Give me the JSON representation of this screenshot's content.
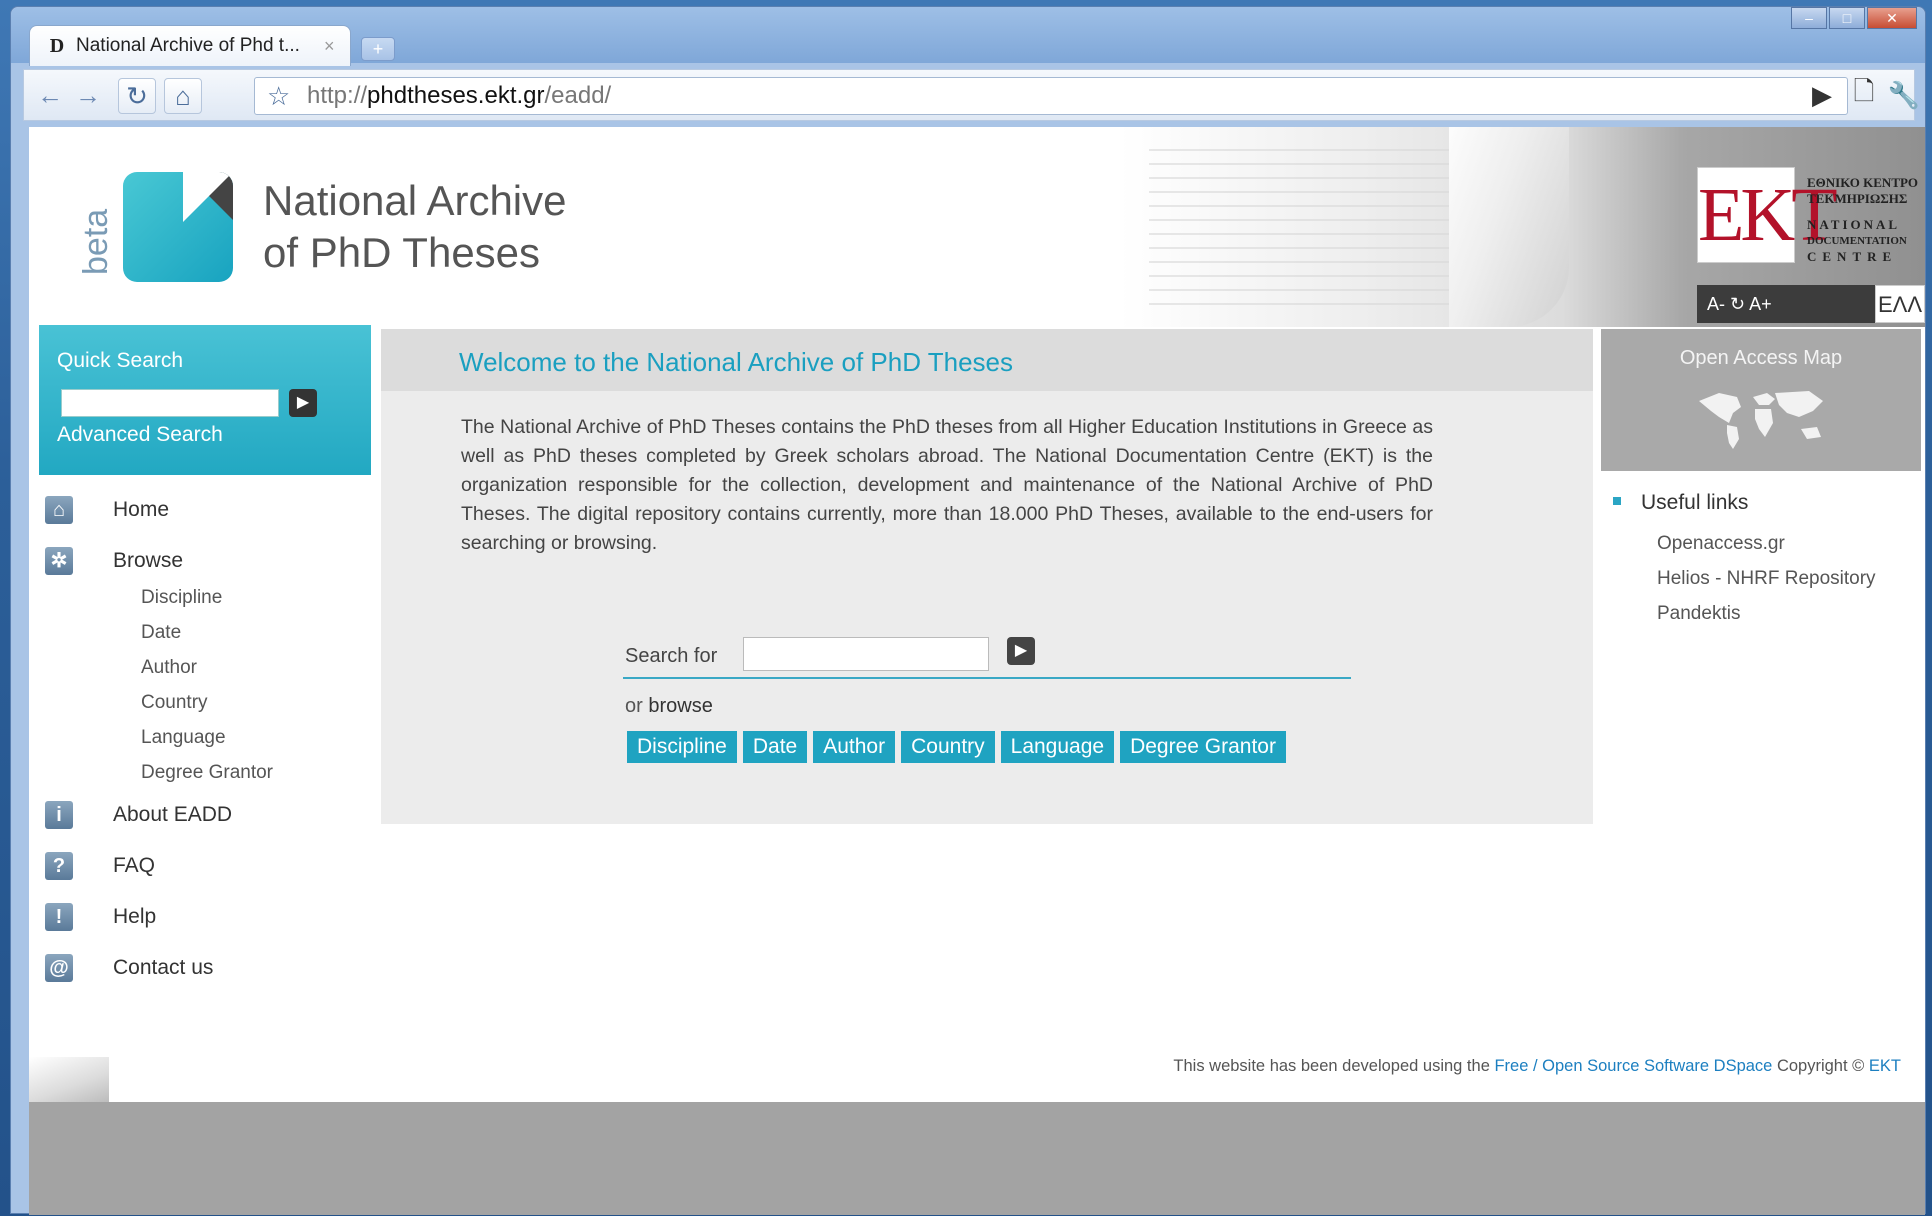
{
  "browser": {
    "tab_title": "National Archive of Phd t...",
    "tab_close": "×",
    "new_tab": "+",
    "url_prefix": "http://",
    "url_host": "phdtheses.ekt.gr",
    "url_path": "/eadd/"
  },
  "header": {
    "beta": "beta",
    "site_name_line1": "National Archive",
    "site_name_line2": "of PhD Theses",
    "ekt_logo": "EKT",
    "ekt_greek_line1": "ΕΘΝΙΚΟ ΚΕΝΤΡΟ",
    "ekt_greek_line2": "ΤΕΚΜΗΡΙΩΣΗΣ",
    "ekt_en_line1": "NATIONAL",
    "ekt_en_line2": "DOCUMENTATION",
    "ekt_en_line3": "CENTRE",
    "font_sizer": "A- ↻ A+",
    "lang_toggle": "ΕΛΛ"
  },
  "quick_search": {
    "title": "Quick Search",
    "advanced": "Advanced Search"
  },
  "nav": {
    "home": "Home",
    "browse": "Browse",
    "browse_items": [
      "Discipline",
      "Date",
      "Author",
      "Country",
      "Language",
      "Degree Grantor"
    ],
    "about": "About EADD",
    "faq": "FAQ",
    "help": "Help",
    "contact": "Contact us"
  },
  "main": {
    "title": "Welcome to the National Archive of PhD Theses",
    "intro": "The National Archive of PhD Theses contains the PhD theses from all Higher Education Institutions in Greece as well as PhD theses completed by Greek scholars abroad. The National Documentation Centre (EKT) is the organization responsible for the collection, development and maintenance of the National Archive of PhD Theses. The digital repository contains currently, more than 18.000 PhD Theses, available to the end-users for searching or browsing.",
    "search_label": "Search for",
    "or_text": "or",
    "browse_text": "browse",
    "browse_buttons": [
      "Discipline",
      "Date",
      "Author",
      "Country",
      "Language",
      "Degree Grantor"
    ]
  },
  "right": {
    "map_title": "Open Access Map",
    "useful_title": "Useful links",
    "links": [
      "Openaccess.gr",
      "Helios - NHRF Repository",
      "Pandektis"
    ]
  },
  "footer": {
    "prefix": "This website has been developed using the",
    "link": "Free / Open Source Software DSpace",
    "copyright": "Copyright  ©",
    "ekt": "EKT"
  },
  "colors": {
    "accent": "#1fa3c1",
    "title": "#1a9fc0",
    "ekt_red": "#b3122a"
  }
}
